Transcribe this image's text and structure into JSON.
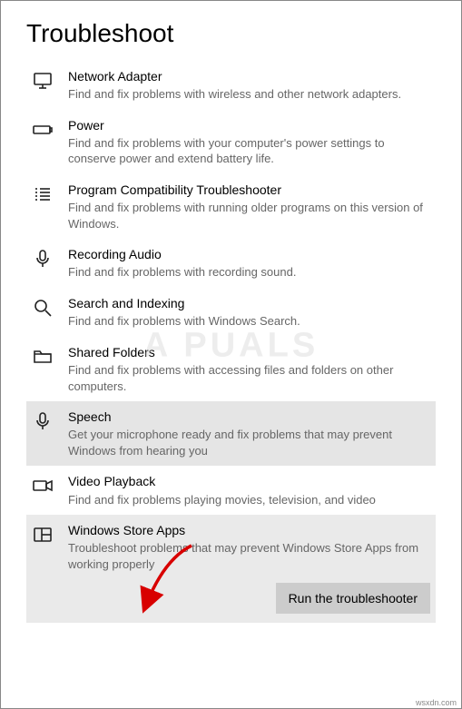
{
  "page": {
    "title": "Troubleshoot"
  },
  "items": [
    {
      "title": "Network Adapter",
      "desc": "Find and fix problems with wireless and other network adapters.",
      "selected": false,
      "icon": "monitor"
    },
    {
      "title": "Power",
      "desc": "Find and fix problems with your computer's power settings to conserve power and extend battery life.",
      "selected": false,
      "icon": "battery"
    },
    {
      "title": "Program Compatibility Troubleshooter",
      "desc": "Find and fix problems with running older programs on this version of Windows.",
      "selected": false,
      "icon": "list"
    },
    {
      "title": "Recording Audio",
      "desc": "Find and fix problems with recording sound.",
      "selected": false,
      "icon": "mic"
    },
    {
      "title": "Search and Indexing",
      "desc": "Find and fix problems with Windows Search.",
      "selected": false,
      "icon": "search"
    },
    {
      "title": "Shared Folders",
      "desc": "Find and fix problems with accessing files and folders on other computers.",
      "selected": false,
      "icon": "folder"
    },
    {
      "title": "Speech",
      "desc": "Get your microphone ready and fix problems that may prevent Windows from hearing you",
      "selected": true,
      "icon": "mic"
    },
    {
      "title": "Video Playback",
      "desc": "Find and fix problems playing movies, television, and video",
      "selected": false,
      "icon": "video"
    },
    {
      "title": "Windows Store Apps",
      "desc": "Troubleshoot problems that may prevent Windows Store Apps from working properly",
      "selected": false,
      "hover": true,
      "icon": "apps"
    }
  ],
  "button": {
    "run": "Run the troubleshooter"
  },
  "watermark": "A  PUALS",
  "footer": "wsxdn.com"
}
